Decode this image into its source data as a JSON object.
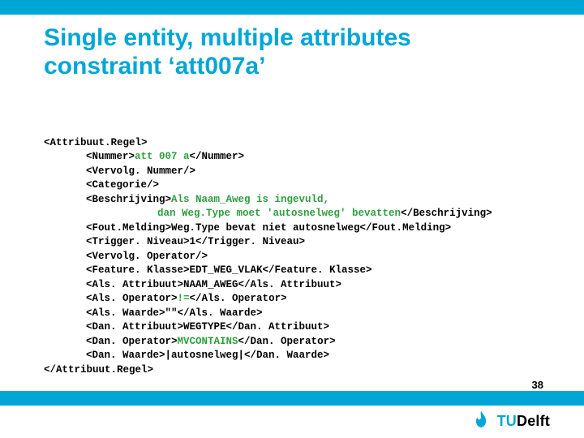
{
  "title_line1": "Single entity, multiple attributes",
  "title_line2": "constraint ‘att007a’",
  "page_number": "38",
  "logo_text": "Delft",
  "code": {
    "l0a": "<Attribuut.Regel>",
    "l1a": "<Nummer>",
    "l1v": "att 007 a",
    "l1b": "</Nummer>",
    "l2a": "<Vervolg. Nummer/>",
    "l3a": "<Categorie/>",
    "l4a": "<Beschrijving>",
    "l4v": "Als Naam_Aweg is ingevuld,",
    "l5v": "dan Weg.Type moet 'autosnelweg' bevatten",
    "l5b": "</Beschrijving>",
    "l6a": "<Fout.Melding>Weg.Type bevat niet autosnelweg</Fout.Melding>",
    "l7a": "<Trigger. Niveau>1</Trigger. Niveau>",
    "l8a": "<Vervolg. Operator/>",
    "l9a": "<Feature. Klasse>EDT_WEG_VLAK</Feature. Klasse>",
    "l10a": "<Als. Attribuut>NAAM_AWEG</Als. Attribuut>",
    "l11a": "<Als. Operator>",
    "l11v": "!=",
    "l11b": "</Als. Operator>",
    "l12a": "<Als. Waarde>\"\"</Als. Waarde>",
    "l13a": "<Dan. Attribuut>WEGTYPE</Dan. Attribuut>",
    "l14a": "<Dan. Operator>",
    "l14v": "MVCONTAINS",
    "l14b": "</Dan. Operator>",
    "l15a": "<Dan. Waarde>|autosnelweg|</Dan. Waarde>",
    "l16a": "</Attribuut.Regel>"
  }
}
